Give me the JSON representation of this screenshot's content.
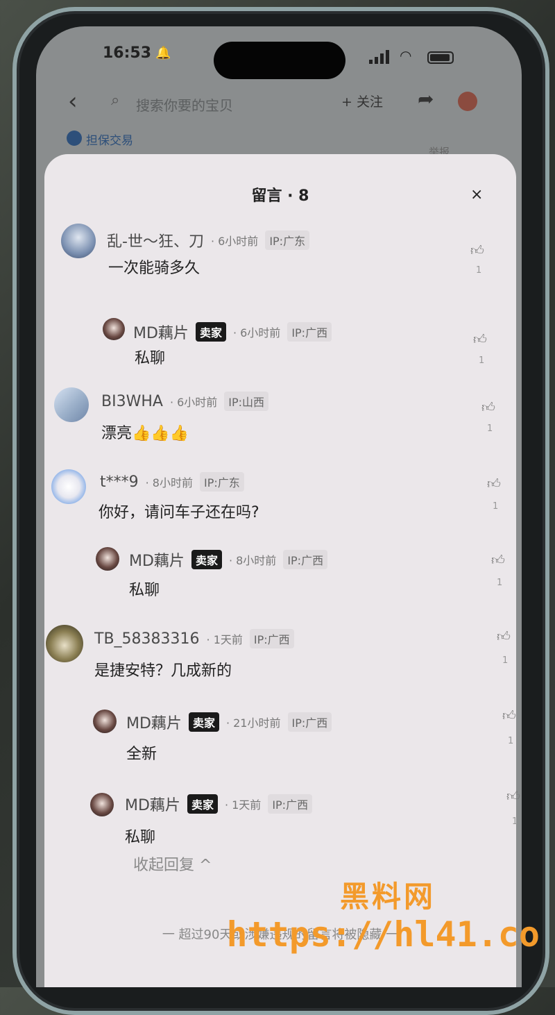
{
  "status": {
    "time": "16:53"
  },
  "nav": {
    "search_placeholder": "搜索你要的宝贝",
    "follow_label": "+ 关注"
  },
  "sub": {
    "guarantee": "担保交易",
    "report": "举报"
  },
  "sheet": {
    "title": "留言 · 8",
    "close": "×"
  },
  "comments": [
    {
      "name": "乱-世～狂、刀",
      "badge": "",
      "time": "· 6小时前",
      "ip": "IP:广东",
      "text": "一次能骑多久",
      "likes": "1"
    },
    {
      "name": "MD藕片",
      "badge": "卖家",
      "time": "· 6小时前",
      "ip": "IP:广西",
      "text": "私聊",
      "likes": "1"
    },
    {
      "name": "BI3WHA",
      "badge": "",
      "time": "· 6小时前",
      "ip": "IP:山西",
      "text": "漂亮👍👍👍",
      "likes": "1"
    },
    {
      "name": "t***9",
      "badge": "",
      "time": "· 8小时前",
      "ip": "IP:广东",
      "text": "你好，请问车子还在吗?",
      "likes": "1"
    },
    {
      "name": "MD藕片",
      "badge": "卖家",
      "time": "· 8小时前",
      "ip": "IP:广西",
      "text": "私聊",
      "likes": "1"
    },
    {
      "name": "TB_58383316",
      "badge": "",
      "time": "· 1天前",
      "ip": "IP:广西",
      "text": "是捷安特？几成新的",
      "likes": "1"
    },
    {
      "name": "MD藕片",
      "badge": "卖家",
      "time": "· 21小时前",
      "ip": "IP:广西",
      "text": "全新",
      "likes": "1"
    },
    {
      "name": "MD藕片",
      "badge": "卖家",
      "time": "· 1天前",
      "ip": "IP:广西",
      "text": "私聊",
      "likes": "1"
    }
  ],
  "collapse_label": "收起回复 ^",
  "footer_note": "一 超过90天或涉嫌违规的留言将被隐藏 一",
  "watermark": {
    "title": "黑料网",
    "url": "https://hl41.co"
  },
  "icons": {
    "back": "chevron-left-icon",
    "search": "search-icon",
    "share": "share-icon",
    "like": "thumb-up-icon",
    "close": "close-icon"
  }
}
